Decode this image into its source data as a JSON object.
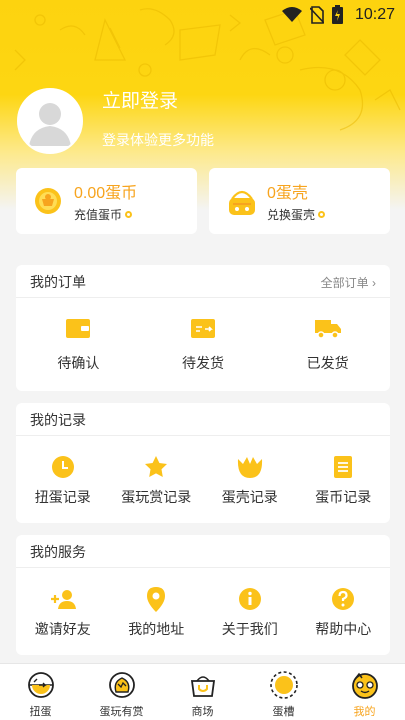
{
  "status": {
    "time": "10:27"
  },
  "profile": {
    "login_title": "立即登录",
    "login_subtitle": "登录体验更多功能"
  },
  "wallet": {
    "coins": {
      "value": "0.00蛋币",
      "action": "充值蛋币"
    },
    "shells": {
      "value": "0蛋壳",
      "action": "兑换蛋壳"
    }
  },
  "orders": {
    "title": "我的订单",
    "more": "全部订单 ›",
    "items": [
      {
        "label": "待确认",
        "icon": "wallet-icon"
      },
      {
        "label": "待发货",
        "icon": "ticket-icon"
      },
      {
        "label": "已发货",
        "icon": "truck-icon"
      }
    ]
  },
  "records": {
    "title": "我的记录",
    "items": [
      {
        "label": "扭蛋记录",
        "icon": "clock-icon"
      },
      {
        "label": "蛋玩赏记录",
        "icon": "star-icon"
      },
      {
        "label": "蛋壳记录",
        "icon": "shell-icon"
      },
      {
        "label": "蛋币记录",
        "icon": "document-icon"
      }
    ]
  },
  "services": {
    "title": "我的服务",
    "items": [
      {
        "label": "邀请好友",
        "icon": "add-person-icon"
      },
      {
        "label": "我的地址",
        "icon": "location-pin-icon"
      },
      {
        "label": "关于我们",
        "icon": "info-icon"
      },
      {
        "label": "帮助中心",
        "icon": "question-icon"
      }
    ]
  },
  "tabbar": {
    "active": "我的",
    "tabs": [
      {
        "label": "扭蛋",
        "icon": "capsule-icon"
      },
      {
        "label": "蛋玩有赏",
        "icon": "cracked-egg-icon"
      },
      {
        "label": "商场",
        "icon": "basket-icon"
      },
      {
        "label": "蛋槽",
        "icon": "egg-slot-icon"
      },
      {
        "label": "我的",
        "icon": "mascot-icon"
      }
    ]
  },
  "colors": {
    "brand_yellow": "#fdd30f",
    "accent_orange": "#f7a41e",
    "icon_yellow": "#fbc21a"
  }
}
